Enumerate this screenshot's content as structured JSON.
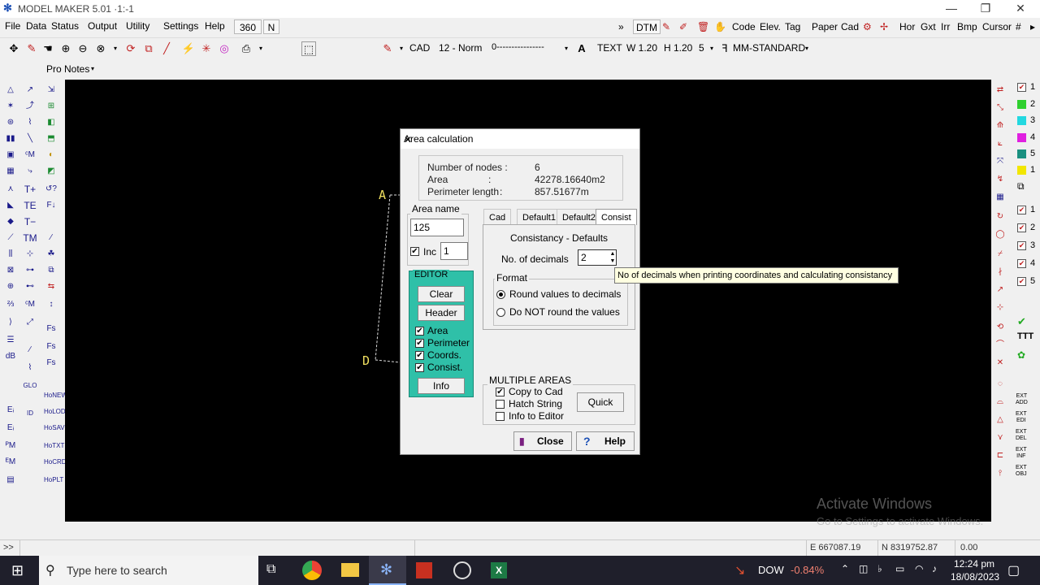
{
  "window": {
    "title": "MODEL MAKER 5.01  ·1:-1",
    "minimize": "—",
    "restore": "❐",
    "close": "✕"
  },
  "menu": [
    "File",
    "Data",
    "Status",
    "Output",
    "Utility",
    "Settings",
    "Help"
  ],
  "menu_box_360": "360",
  "menu_box_n": "N",
  "toolbar_right": [
    "DTM",
    "Code",
    "Elev.",
    "Tag",
    "Paper",
    "Cad",
    "Hor",
    "Gxt",
    "Irr",
    "Bmp",
    "Cursor"
  ],
  "toolbar2": {
    "layer": "CAD",
    "pen": "12 - Norm",
    "linetype": "0----------------",
    "text": "TEXT",
    "width": "W 1.20",
    "height": "H 1.20",
    "num": "5",
    "style": "MM-STANDARD"
  },
  "pro_notes": "Pro Notes",
  "canvas": {
    "label_a": "A",
    "label_d": "D"
  },
  "dialog": {
    "title": "Area calculation",
    "info": {
      "nodes_label": "Number of nodes :",
      "nodes_value": "6",
      "area_label": "Area",
      "area_colon": ":",
      "area_value": "42278.16640m2",
      "perimeter_label": "Perimeter length",
      "perimeter_colon": ":",
      "perimeter_value": "857.51677m"
    },
    "area_name_legend": "Area name",
    "area_name_value": "125",
    "inc_label": "Inc",
    "inc_value": "1",
    "editor": {
      "legend": "EDITOR",
      "clear": "Clear",
      "header": "Header",
      "checks": [
        "Area",
        "Perimeter",
        "Coords.",
        "Consist."
      ],
      "info": "Info"
    },
    "tabs": [
      "Cad",
      "Default1",
      "Default2",
      "Consist"
    ],
    "active_tab": "Consist",
    "consist_title": "Consistancy - Defaults",
    "decimals_label": "No. of decimals",
    "decimals_value": "2",
    "format_legend": "Format",
    "format_options": [
      "Round values to decimals",
      "Do NOT round the values"
    ],
    "multiple_legend": "MULTIPLE AREAS",
    "multiple_checks": [
      "Copy to Cad",
      "Hatch String",
      "Info to Editor"
    ],
    "quick": "Quick",
    "close": "Close",
    "help": "Help"
  },
  "tooltip": "No of decimals when printing coordinates and calculating consistancy",
  "right_layers": [
    "1",
    "2",
    "3",
    "4",
    "5",
    "1"
  ],
  "right_checks": [
    "1",
    "2",
    "3",
    "4",
    "5"
  ],
  "layer_colors": [
    "#f2e600",
    "#2fd02f",
    "#23d8e0",
    "#e020e0",
    "#1a9080",
    "#f2e600"
  ],
  "status": {
    "prompt": ">>",
    "easting": "E 667087.19",
    "northing": "N 8319752.87",
    "value": "0.00"
  },
  "watermark": {
    "line1": "Activate Windows",
    "line2": "Go to Settings to activate Windows."
  },
  "taskbar": {
    "search_placeholder": "Type here to search",
    "stock_name": "DOW",
    "stock_change": "-0.84%",
    "time": "12:24 pm",
    "date": "18/08/2023"
  }
}
